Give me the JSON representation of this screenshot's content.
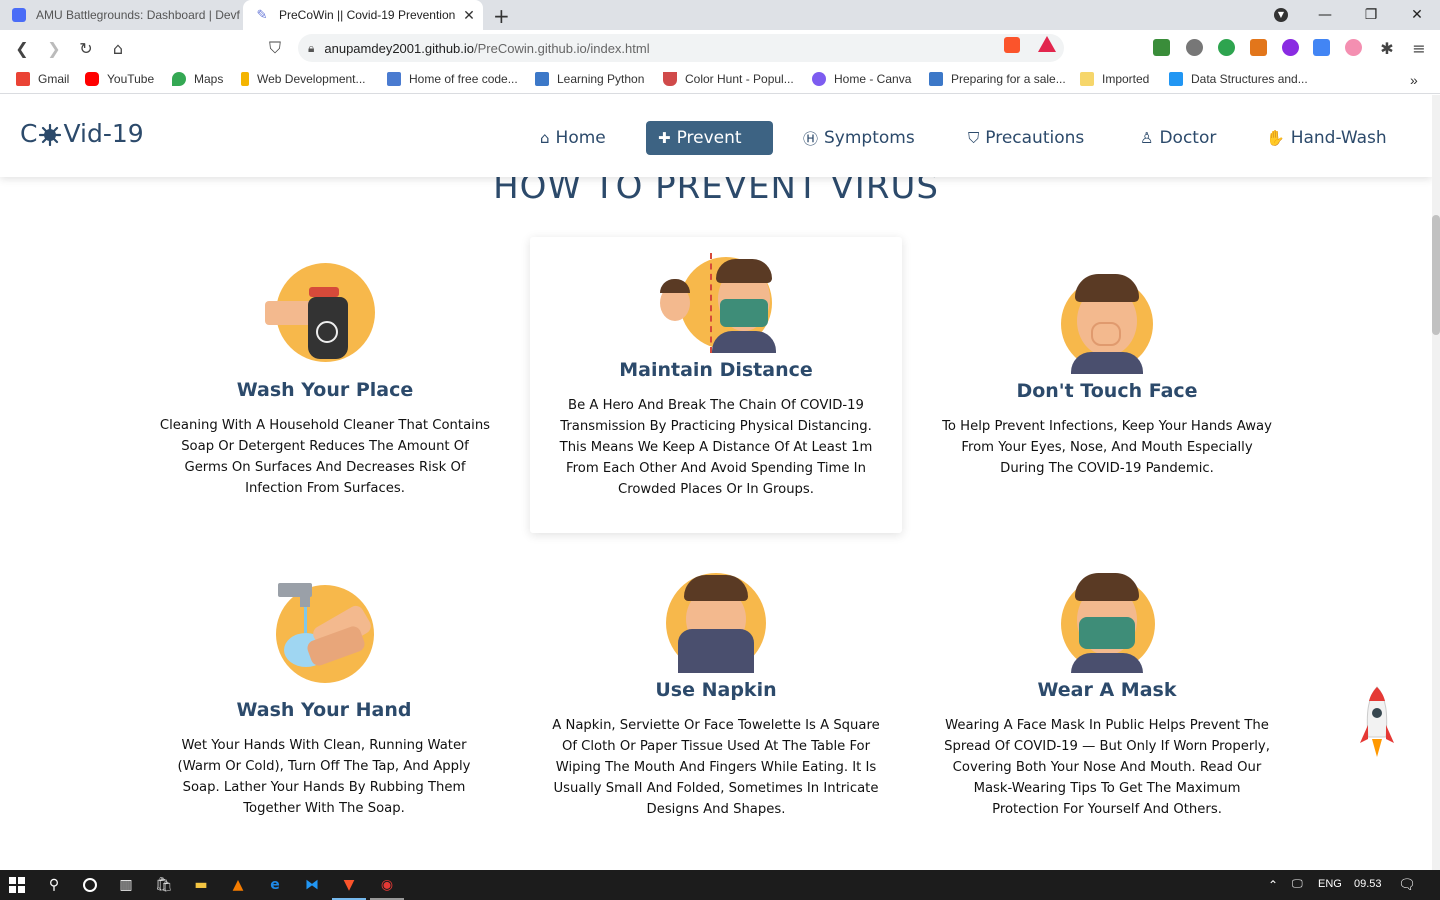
{
  "browser": {
    "tabs": [
      {
        "title": "AMU Battlegrounds: Dashboard | Devf",
        "active": false
      },
      {
        "title": "PreCoWin || Covid-19 Prevention",
        "active": true
      }
    ],
    "new_tab_label": "+",
    "window_controls": {
      "minimize": "—",
      "restore": "❐",
      "close": "✕"
    },
    "url_host": "anupamdey2001.github.io",
    "url_path": "/PreCowin.github.io/index.html",
    "bookmarks": [
      {
        "label": "Gmail",
        "color": "#ea4335"
      },
      {
        "label": "YouTube",
        "color": "#ff0000"
      },
      {
        "label": "Maps",
        "color": "#34a853"
      },
      {
        "label": "Web Development...",
        "color": "#f4b400"
      },
      {
        "label": "Home of free code...",
        "color": "#4a7bd0"
      },
      {
        "label": "Learning Python",
        "color": "#3c78c8"
      },
      {
        "label": "Color Hunt - Popul...",
        "color": "#d04a4a"
      },
      {
        "label": "Home - Canva",
        "color": "#7d5cf0"
      },
      {
        "label": "Preparing for a sale...",
        "color": "#3c78c8"
      },
      {
        "label": "Imported",
        "color": "#f6d66b"
      },
      {
        "label": "Data Structures and...",
        "color": "#2196f3"
      }
    ],
    "more_bookmarks": "»"
  },
  "site": {
    "logo": {
      "prefix": "C",
      "suffix": "Vid-19"
    },
    "nav": [
      {
        "label": "Home",
        "icon": "home-icon",
        "glyph": "⌂",
        "active": false
      },
      {
        "label": "Prevent",
        "icon": "first-aid-icon",
        "glyph": "✚",
        "active": true
      },
      {
        "label": "Symptoms",
        "icon": "hospital-icon",
        "glyph": "Ⓗ",
        "active": false
      },
      {
        "label": "Precautions",
        "icon": "shield-icon",
        "glyph": "⛉",
        "active": false
      },
      {
        "label": "Doctor",
        "icon": "doctor-icon",
        "glyph": "♙",
        "active": false
      },
      {
        "label": "Hand-Wash",
        "icon": "hands-wash-icon",
        "glyph": "✋",
        "active": false
      }
    ],
    "section_title": "HOW TO PREVENT VIRUS",
    "cards": [
      {
        "title": "Wash Your Place",
        "text": "Cleaning With A Household Cleaner That Contains Soap Or Detergent Reduces The Amount Of Germs On Surfaces And Decreases Risk Of Infection From Surfaces.",
        "illustration": "spray-bottle-illustration"
      },
      {
        "title": "Maintain Distance",
        "text": "Be A Hero And Break The Chain Of COVID-19 Transmission By Practicing Physical Distancing. This Means We Keep A Distance Of At Least 1m From Each Other And Avoid Spending Time In Crowded Places Or In Groups.",
        "illustration": "distance-illustration"
      },
      {
        "title": "Don't Touch Face",
        "text": "To Help Prevent Infections, Keep Your Hands Away From Your Eyes, Nose, And Mouth Especially During The COVID-19 Pandemic.",
        "illustration": "touch-face-illustration"
      },
      {
        "title": "Wash Your Hand",
        "text": "Wet Your Hands With Clean, Running Water (Warm Or Cold), Turn Off The Tap, And Apply Soap. Lather Your Hands By Rubbing Them Together With The Soap.",
        "illustration": "hand-wash-illustration"
      },
      {
        "title": "Use Napkin",
        "text": "A Napkin, Serviette Or Face Towelette Is A Square Of Cloth Or Paper Tissue Used At The Table For Wiping The Mouth And Fingers While Eating. It Is Usually Small And Folded, Sometimes In Intricate Designs And Shapes.",
        "illustration": "napkin-illustration"
      },
      {
        "title": "Wear A Mask",
        "text": "Wearing A Face Mask In Public Helps Prevent The Spread Of COVID-19 — But Only If Worn Properly, Covering Both Your Nose And Mouth. Read Our Mask-Wearing Tips To Get The Maximum Protection For Yourself And Others.",
        "illustration": "mask-illustration"
      }
    ]
  },
  "taskbar": {
    "language": "ENG",
    "time": "09.53"
  },
  "colors": {
    "primary": "#2c4a6b",
    "nav_active_bg": "#3d6383",
    "illustration_circle": "#f7b84b"
  }
}
